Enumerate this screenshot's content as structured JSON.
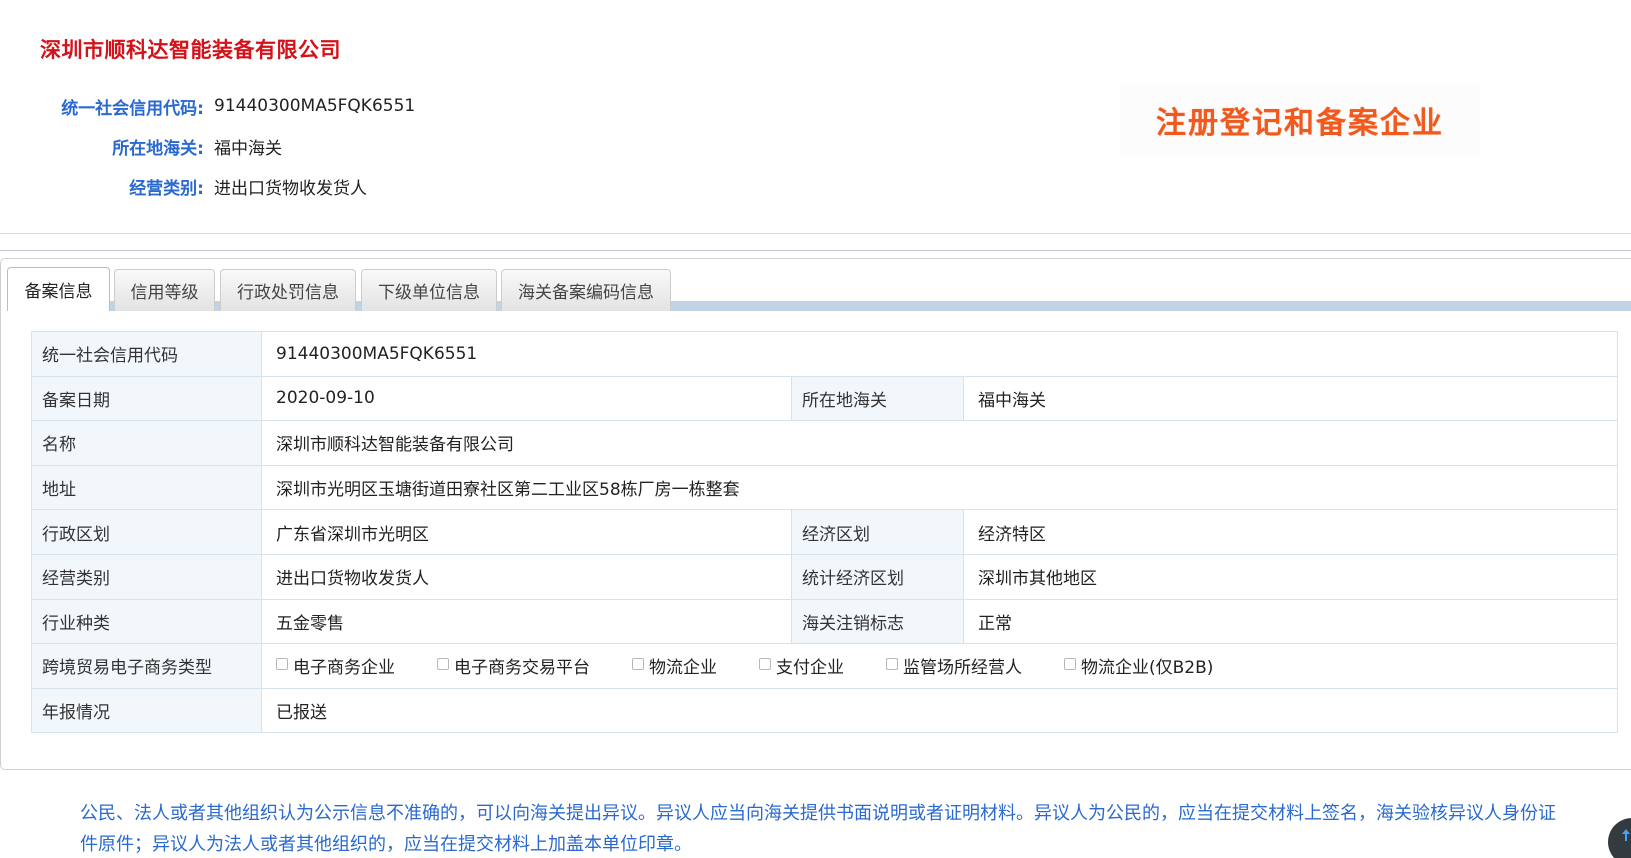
{
  "header": {
    "company_name": "深圳市顺科达智能装备有限公司",
    "fields": [
      {
        "label": "统一社会信用代码:",
        "value": "91440300MA5FQK6551"
      },
      {
        "label": "所在地海关:",
        "value": "福中海关"
      },
      {
        "label": "经营类别:",
        "value": "进出口货物收发货人"
      }
    ],
    "badge": "注册登记和备案企业"
  },
  "tabs": [
    {
      "label": "备案信息",
      "active": true
    },
    {
      "label": "信用等级",
      "active": false
    },
    {
      "label": "行政处罚信息",
      "active": false
    },
    {
      "label": "下级单位信息",
      "active": false
    },
    {
      "label": "海关备案编码信息",
      "active": false
    }
  ],
  "details": {
    "credit_code_label": "统一社会信用代码",
    "credit_code": "91440300MA5FQK6551",
    "record_date_label": "备案日期",
    "record_date": "2020-09-10",
    "customs_label": "所在地海关",
    "customs": "福中海关",
    "name_label": "名称",
    "name": "深圳市顺科达智能装备有限公司",
    "address_label": "地址",
    "address": "深圳市光明区玉塘街道田寮社区第二工业区58栋厂房一栋整套",
    "admin_region_label": "行政区划",
    "admin_region": "广东省深圳市光明区",
    "econ_region_label": "经济区划",
    "econ_region": "经济特区",
    "biz_type_label": "经营类别",
    "biz_type": "进出口货物收发货人",
    "stat_region_label": "统计经济区划",
    "stat_region": "深圳市其他地区",
    "industry_label": "行业种类",
    "industry": "五金零售",
    "cancel_flag_label": "海关注销标志",
    "cancel_flag": "正常",
    "ecommerce_label": "跨境贸易电子商务类型",
    "ecommerce_options": [
      {
        "label": "电子商务企业",
        "checked": false
      },
      {
        "label": "电子商务交易平台",
        "checked": false
      },
      {
        "label": "物流企业",
        "checked": false
      },
      {
        "label": "支付企业",
        "checked": false
      },
      {
        "label": "监管场所经营人",
        "checked": false
      },
      {
        "label": "物流企业(仅B2B)",
        "checked": false
      }
    ],
    "annual_report_label": "年报情况",
    "annual_report": "已报送"
  },
  "notice": "公民、法人或者其他组织认为公示信息不准确的，可以向海关提出异议。异议人应当向海关提供书面说明或者证明材料。异议人为公民的，应当在提交材料上签名，海关验核异议人身份证件原件；异议人为法人或者其他组织的，应当在提交材料上加盖本单位印章。",
  "colors": {
    "title_red": "#d4121a",
    "label_blue": "#2a6ad0",
    "badge_orange": "#f05a1e",
    "tab_strip": "#c0d4e6"
  },
  "icons": {
    "scroll_top": "arrow-up-icon"
  }
}
